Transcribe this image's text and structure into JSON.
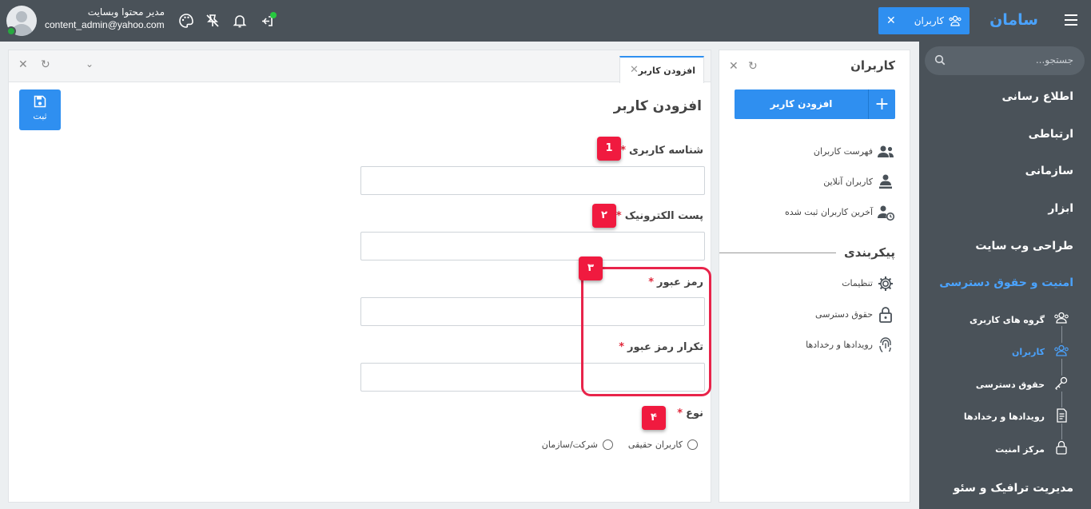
{
  "topbar": {
    "brand": "سامان",
    "active_tab": "کاربران",
    "user_name": "مدیر محتوا وبسایت",
    "user_email": "content_admin@yahoo.com"
  },
  "sidebar": {
    "search_placeholder": "جستجو...",
    "main_items": [
      "اطلاع رسانی",
      "ارتباطی",
      "سازمانی",
      "ابزار",
      "طراحی وب سایت",
      "امنیت و حقوق دسترسی",
      "مدیریت ترافیک و سئو"
    ],
    "sub_items": [
      "گروه های کاربری",
      "کاربران",
      "حقوق دسترسی",
      "رویدادها و رخدادها",
      "مرکز امنیت"
    ]
  },
  "users_panel": {
    "title": "کاربران",
    "add_button": "افزودن کاربر",
    "links": [
      "فهرست کاربران",
      "کاربران آنلاین",
      "آخرین کاربران ثبت شده"
    ],
    "section_title": "پیکربندی",
    "config_links": [
      "تنظیمات",
      "حقوق دسترسی",
      "رویدادها و رخدادها"
    ]
  },
  "form": {
    "tab_label": "افزودن کاربر",
    "save_label": "ثبت",
    "title": "افزودن کاربر",
    "fields": [
      {
        "label": "شناسه کاربری",
        "required": "*",
        "badge": "1"
      },
      {
        "label": "پست الکترونیک",
        "required": "*",
        "badge": "۲"
      },
      {
        "label": "رمز عبور",
        "required": "*",
        "badge": "۳"
      },
      {
        "label": "تکرار رمز عبور",
        "required": "*"
      }
    ],
    "type_label": "نوع",
    "type_required": "*",
    "type_badge": "۴",
    "type_options": [
      "کاربران حقیقی",
      "شرکت/سازمان"
    ]
  },
  "colors": {
    "topbar": "#4a5259",
    "accent": "#2f8ff0",
    "required": "#e0283b",
    "badge": "#f01a3f"
  }
}
